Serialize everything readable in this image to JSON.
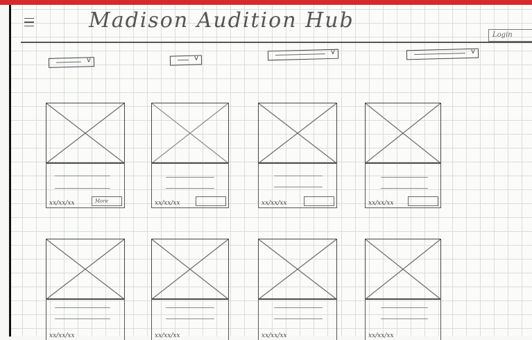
{
  "header": {
    "title": "Madison Audition Hub",
    "login_label": "Login"
  },
  "filters": [
    {
      "selected": "~~"
    },
    {
      "selected": "~"
    },
    {
      "selected": "~~~"
    },
    {
      "selected": "~~~"
    }
  ],
  "cards": [
    {
      "date": "xx/xx/xx",
      "more_label": "More"
    },
    {
      "date": "xx/xx/xx",
      "more_label": ""
    },
    {
      "date": "xx/xx/xx",
      "more_label": ""
    },
    {
      "date": "xx/xx/xx",
      "more_label": ""
    },
    {
      "date": "xx/xx/xx"
    },
    {
      "date": "xx/xx/xx"
    },
    {
      "date": "xx/xx/xx"
    },
    {
      "date": "xx/xx/xx"
    }
  ],
  "colors": {
    "accent_bar": "#d8282b",
    "pencil": "#444444",
    "grid": "#d9dde0"
  },
  "icons": [
    "hamburger-menu-icon",
    "chevron-down-icon",
    "image-placeholder-icon"
  ]
}
